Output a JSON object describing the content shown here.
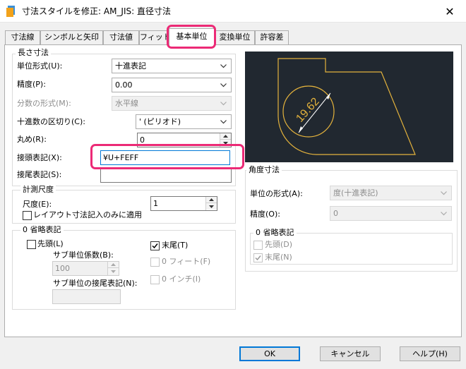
{
  "window": {
    "title": "寸法スタイルを修正: AM_JIS: 直径寸法",
    "close_glyph": "✕"
  },
  "tabs": [
    {
      "label": "寸法線"
    },
    {
      "label": "シンボルと矢印"
    },
    {
      "label": "寸法値"
    },
    {
      "label": "フィット"
    },
    {
      "label": "基本単位"
    },
    {
      "label": "変換単位"
    },
    {
      "label": "許容差"
    }
  ],
  "linear": {
    "title": "長さ寸法",
    "unit_format": {
      "label": "単位形式(U):",
      "value": "十進表記"
    },
    "precision": {
      "label": "精度(P):",
      "value": "0.00"
    },
    "fraction_format": {
      "label": "分数の形式(M):",
      "value": "水平線"
    },
    "decimal_separator": {
      "label": "十進数の区切り(C):",
      "value": "' (ピリオド)"
    },
    "round_off": {
      "label": "丸め(R):",
      "value": "0"
    },
    "prefix": {
      "label": "接頭表記(X):",
      "value": "¥U+FEFF"
    },
    "suffix": {
      "label": "接尾表記(S):",
      "value": ""
    }
  },
  "measurement_scale": {
    "title": "計測尺度",
    "scale_factor": {
      "label": "尺度(E):",
      "value": "1"
    },
    "layout_only": {
      "label": "レイアウト寸法記入のみに適用",
      "checked": false
    }
  },
  "zero_suppression": {
    "title": "0 省略表記",
    "leading": {
      "label": "先頭(L)",
      "checked": false
    },
    "trailing": {
      "label": "末尾(T)",
      "checked": true
    },
    "sub_units_factor": {
      "label": "サブ単位係数(B):",
      "value": "100"
    },
    "sub_unit_suffix": {
      "label": "サブ単位の接尾表記(N):",
      "value": ""
    },
    "feet": {
      "label": "0 フィート(F)",
      "checked": false
    },
    "inches": {
      "label": "0 インチ(I)",
      "checked": false
    }
  },
  "angular": {
    "title": "角度寸法",
    "units_format": {
      "label": "単位の形式(A):",
      "value": "度(十進表記)"
    },
    "precision": {
      "label": "精度(O):",
      "value": "0"
    },
    "zero_suppression": {
      "title": "0 省略表記",
      "leading": {
        "label": "先頭(D)",
        "checked": false
      },
      "trailing": {
        "label": "末尾(N)",
        "checked": true
      }
    }
  },
  "preview": {
    "dimension_text": "19.62"
  },
  "buttons": {
    "ok": "OK",
    "cancel": "キャンセル",
    "help": "ヘルプ(H)"
  },
  "colors": {
    "highlight": "#ec2a76",
    "preview_bg": "#212830",
    "geometry": "#e3b23c",
    "dimension": "#ffffff",
    "focus": "#0078d7"
  }
}
